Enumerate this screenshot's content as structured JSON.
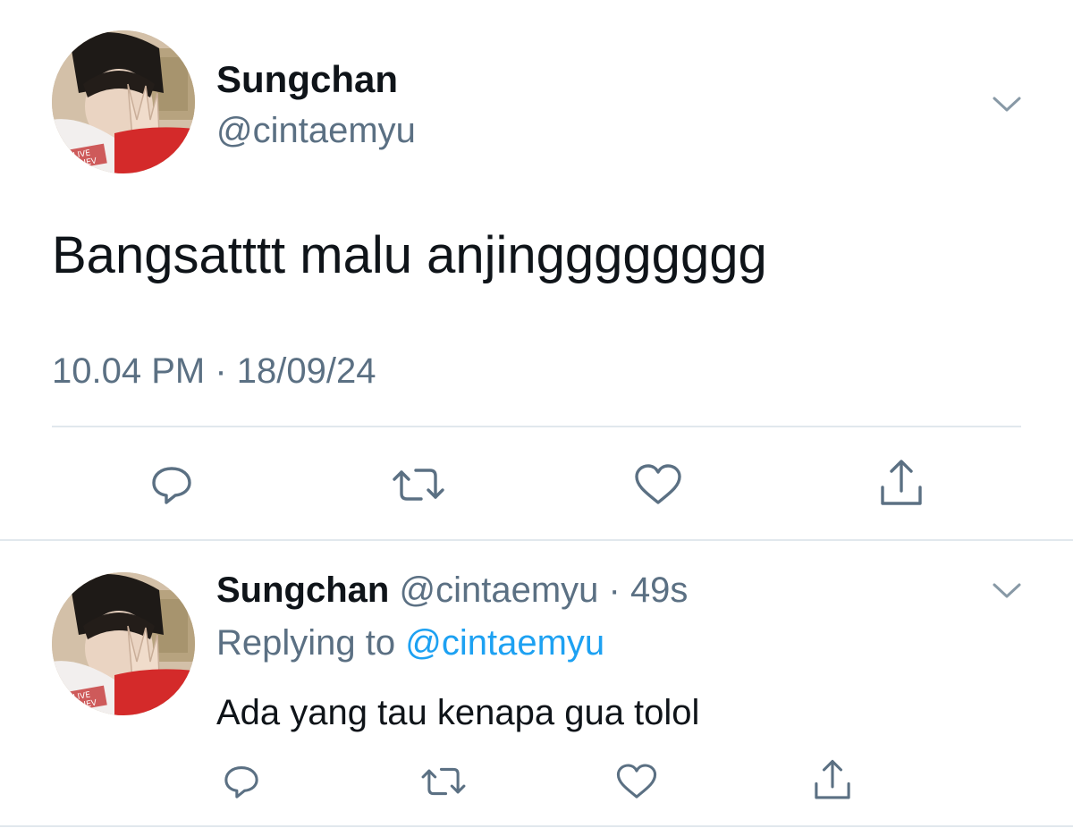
{
  "main_tweet": {
    "display_name": "Sungchan",
    "handle": "@cintaemyu",
    "text": "Bangsatttt malu anjingggggggg",
    "timestamp": "10.04 PM · 18/09/24",
    "actions": [
      "reply-icon",
      "retweet-icon",
      "like-icon",
      "share-icon"
    ]
  },
  "reply_tweet": {
    "display_name": "Sungchan",
    "handle": "@cintaemyu",
    "separator": " · ",
    "age": "49s",
    "replying_prefix": "Replying to ",
    "replying_to": "@cintaemyu",
    "text": "Ada yang tau kenapa gua tolol",
    "actions": [
      "reply-icon",
      "retweet-icon",
      "like-icon",
      "share-icon"
    ]
  },
  "colors": {
    "text_primary": "#0f1419",
    "text_secondary": "#5b7083",
    "link": "#1da1f2",
    "icon": "#5b7083",
    "divider": "#e1e8ed"
  },
  "avatar_text": "LIVE CHEV"
}
